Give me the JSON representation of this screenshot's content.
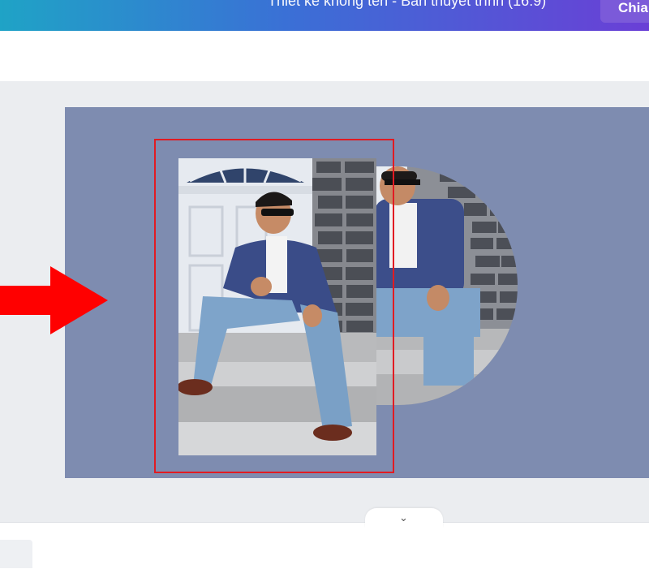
{
  "topbar": {
    "title": "Thiết kế không tên - Bản thuyết trình (16:9)",
    "share_label": "Chia"
  },
  "bottom": {
    "collapse_icon": "⌄"
  },
  "colors": {
    "slide_bg": "#7e8cb0",
    "selection": "#e11b22",
    "arrow": "#ff0000"
  },
  "icons": [
    "arrow-right-icon",
    "chevron-down-icon"
  ]
}
